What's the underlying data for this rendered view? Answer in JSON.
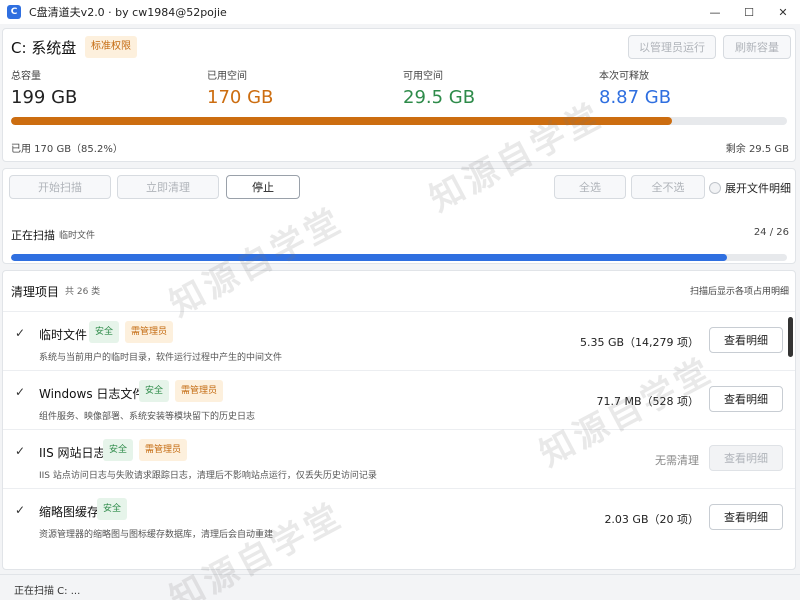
{
  "window": {
    "title": "C盘清道夫v2.0 · by cw1984@52pojie",
    "app_icon": "C",
    "minimize_icon": "—",
    "maximize_icon": "☐",
    "close_icon": "✕"
  },
  "drive": {
    "title": "C: 系统盘",
    "permission_badge": "标准权限",
    "run_as_admin_label": "以管理员运行",
    "refresh_label": "刷新容量",
    "stats": [
      {
        "label": "总容量",
        "value": "199 GB",
        "color": "#222222"
      },
      {
        "label": "已用空间",
        "value": "170 GB",
        "color": "#cc6d10"
      },
      {
        "label": "可用空间",
        "value": "29.5 GB",
        "color": "#2e8b4a"
      },
      {
        "label": "本次可释放",
        "value": "8.87 GB",
        "color": "#2f6fe0"
      }
    ],
    "usage_fraction": 0.852,
    "used_text": "已用 170 GB（85.2%）",
    "remain_text": "剩余 29.5 GB"
  },
  "controls": {
    "start_scan_label": "开始扫描",
    "clean_now_label": "立即清理",
    "stop_label": "停止",
    "select_all_label": "全选",
    "deselect_all_label": "全不选",
    "expand_details_label": "展开文件明细",
    "scan_title": "正在扫描",
    "scan_sub": "临时文件",
    "scan_count": "24 / 26",
    "scan_fraction": 0.923
  },
  "items": {
    "title": "清理项目",
    "count": "共 26 类",
    "hint": "扫描后显示各项占用明细",
    "rows": [
      {
        "check": "✓",
        "name": "临时文件",
        "safe": "安全",
        "admin": "需管理员",
        "desc": "系统与当前用户的临时目录，软件运行过程中产生的中间文件",
        "size": "5.35 GB（14,279 项）",
        "detail": "查看明细",
        "enabled": true
      },
      {
        "check": "✓",
        "name": "Windows 日志文件",
        "safe": "安全",
        "admin": "需管理员",
        "desc": "组件服务、映像部署、系统安装等模块留下的历史日志",
        "size": "71.7 MB（528 项）",
        "detail": "查看明细",
        "enabled": true
      },
      {
        "check": "✓",
        "name": "IIS 网站日志",
        "safe": "安全",
        "admin": "需管理员",
        "desc": "IIS 站点访问日志与失败请求跟踪日志，清理后不影响站点运行，仅丢失历史访问记录",
        "size": "无需清理",
        "detail": "查看明细",
        "enabled": false
      },
      {
        "check": "✓",
        "name": "缩略图缓存",
        "safe": "安全",
        "admin": "",
        "desc": "资源管理器的缩略图与图标缓存数据库，清理后会自动重建",
        "size": "2.03 GB（20 项）",
        "detail": "查看明细",
        "enabled": true
      }
    ]
  },
  "status": {
    "text": "正在扫描 C: ..."
  },
  "watermark": {
    "text": "知源自学堂"
  }
}
